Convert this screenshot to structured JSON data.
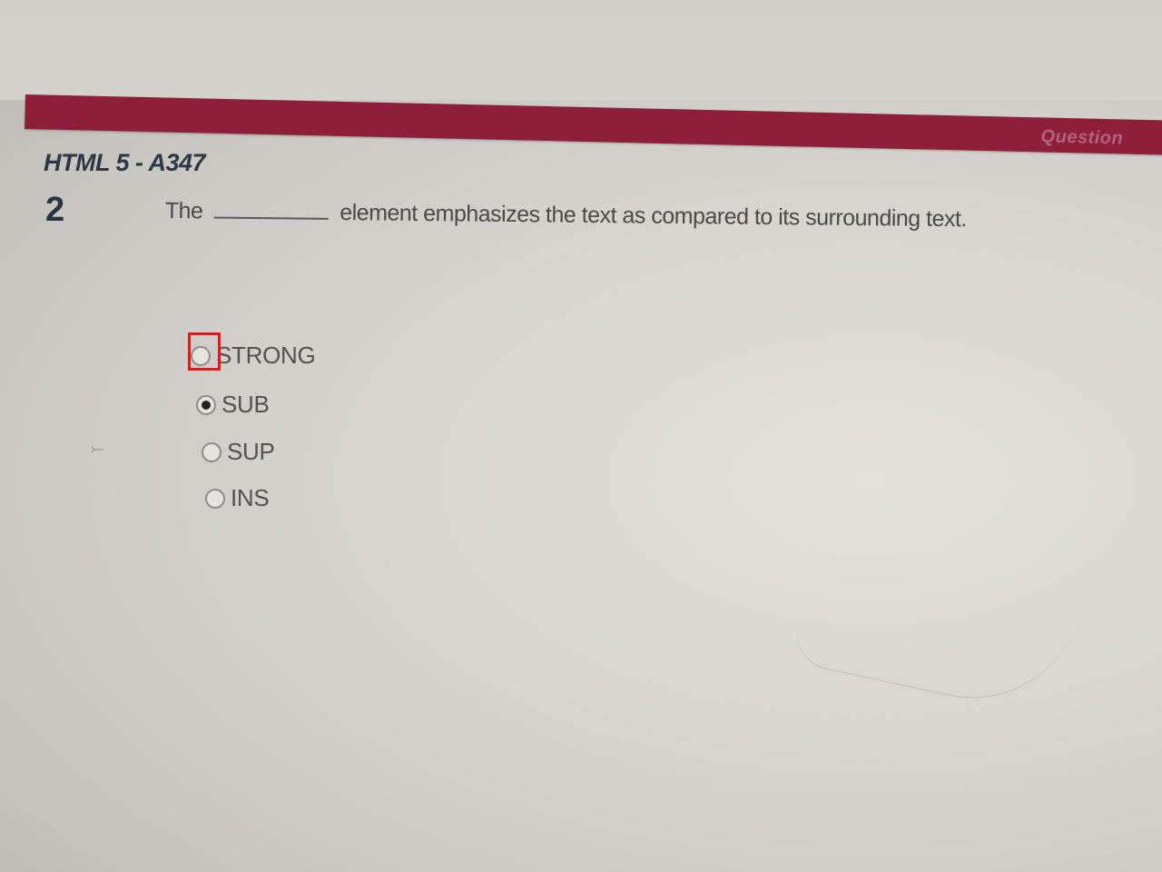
{
  "header": {
    "label": "Question",
    "bar_color": "#8e1f3a"
  },
  "exam": {
    "code": "HTML 5 - A347"
  },
  "question": {
    "number": "2",
    "text_before": "The",
    "text_after": "element emphasizes the text as compared to its surrounding text."
  },
  "options": [
    {
      "label": "STRONG",
      "selected": false
    },
    {
      "label": "SUB",
      "selected": true
    },
    {
      "label": "SUP",
      "selected": false
    },
    {
      "label": "INS",
      "selected": false
    }
  ],
  "highlight": {
    "color": "#e8161c",
    "target": "STRONG"
  }
}
